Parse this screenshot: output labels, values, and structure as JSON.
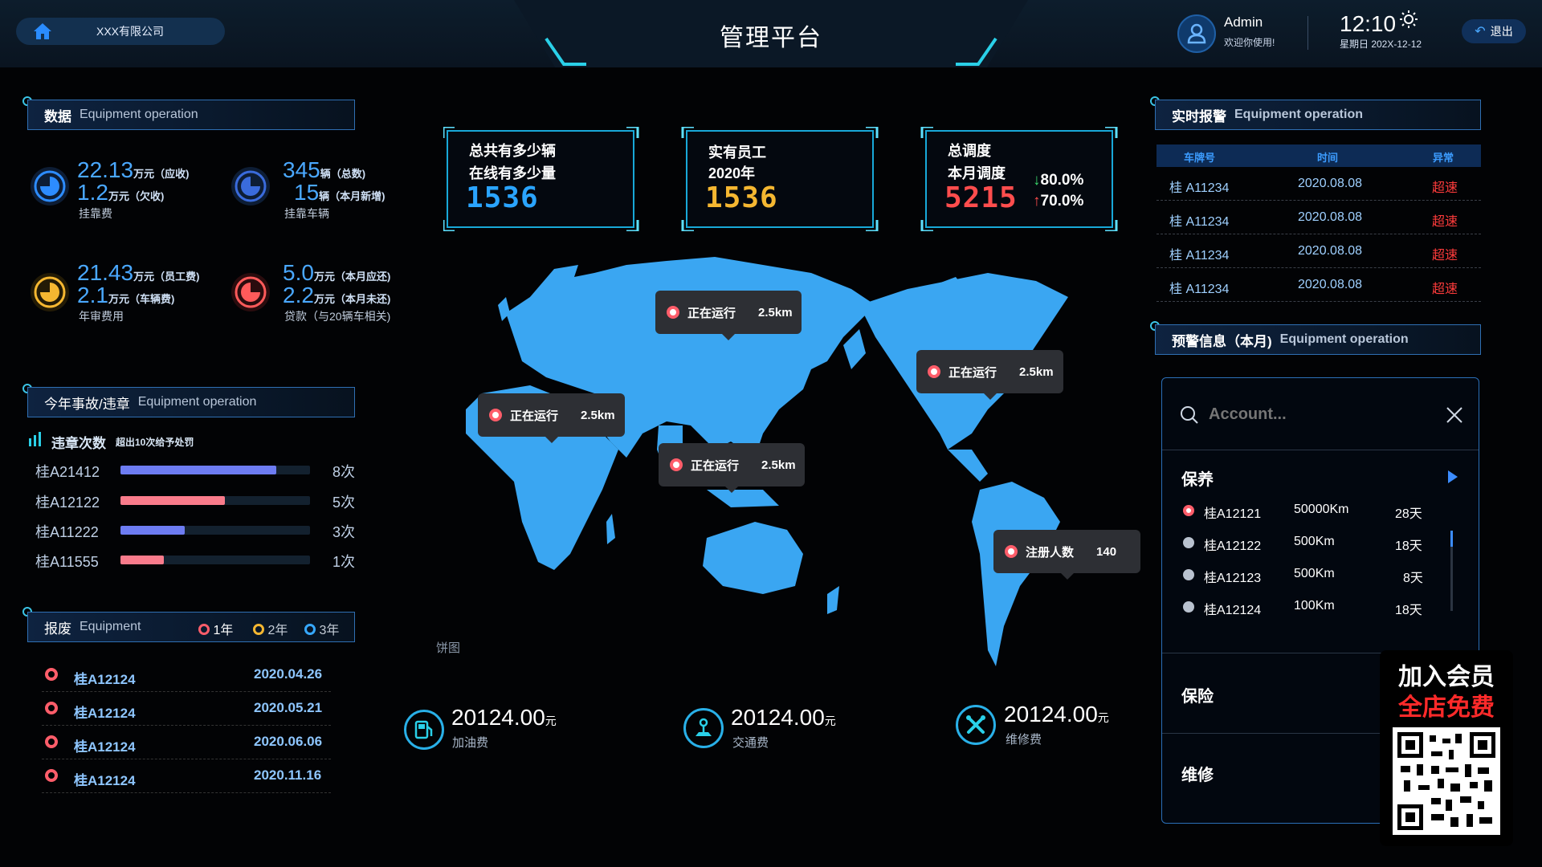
{
  "header": {
    "company": "XXX有限公司",
    "title": "管理平台",
    "user_name": "Admin",
    "user_welcome": "欢迎你使用!",
    "time": "12:10",
    "date": "星期日  202X-12-12",
    "logout": "退出"
  },
  "data_section": {
    "title": "数据",
    "subtitle": "Equipment operation",
    "stats": [
      {
        "v1": "22.13",
        "u1": "万元（应收)",
        "v2": "1.2",
        "u2": "万元（欠收)",
        "label": "挂靠费",
        "color": "#2d8cff"
      },
      {
        "v1": "345",
        "u1": "辆（总数)",
        "v2": "15",
        "u2": "辆（本月新增)",
        "label": "挂靠车辆",
        "color": "#3a6bdc"
      },
      {
        "v1": "21.43",
        "u1": "万元（员工费)",
        "v2": "2.1",
        "u2": "万元（车辆费)",
        "label": "年审费用",
        "color": "#f5b731"
      },
      {
        "v1": "5.0",
        "u1": "万元（本月应还)",
        "v2": "2.2",
        "u2": "万元（本月未还)",
        "label": "贷款（与20辆车相关)",
        "color": "#ff5a5a"
      }
    ]
  },
  "violation_section": {
    "title": "今年事故/违章",
    "subtitle": "Equipment operation",
    "legend_title": "违章次数",
    "legend_note": "超出10次给予处罚",
    "rows": [
      {
        "plate": "桂A21412",
        "count": "8次",
        "ratio": 0.82,
        "color": "#6d7cf2"
      },
      {
        "plate": "桂A12122",
        "count": "5次",
        "ratio": 0.55,
        "color": "#f97b8b"
      },
      {
        "plate": "桂A11222",
        "count": "3次",
        "ratio": 0.34,
        "color": "#6d7cf2"
      },
      {
        "plate": "桂A11555",
        "count": "1次",
        "ratio": 0.23,
        "color": "#f97b8b"
      }
    ]
  },
  "scrap_section": {
    "title": "报废",
    "subtitle": "Equipment",
    "legend": [
      {
        "label": "1年",
        "color": "#ff5d6a"
      },
      {
        "label": "2年",
        "color": "#f5b731"
      },
      {
        "label": "3年",
        "color": "#36a8ff"
      }
    ],
    "rows": [
      {
        "plate": "桂A12124",
        "date": "2020.04.26"
      },
      {
        "plate": "桂A12124",
        "date": "2020.05.21"
      },
      {
        "plate": "桂A12124",
        "date": "2020.06.06"
      },
      {
        "plate": "桂A12124",
        "date": "2020.11.16"
      }
    ]
  },
  "kpis": [
    {
      "line1": "总共有多少辆",
      "line2": "在线有多少量",
      "value": "1536",
      "color": "#2aa4ff"
    },
    {
      "line1": "实有员工",
      "line2": "2020年",
      "value": "1536",
      "color": "#f5b731"
    },
    {
      "line1": "总调度",
      "line2": "本月调度",
      "value": "5215",
      "color": "#ff4d4d",
      "down": "80.0%",
      "up": "70.0%"
    }
  ],
  "map": {
    "pins": [
      {
        "label": "正在运行",
        "value": "2.5km"
      },
      {
        "label": "正在运行",
        "value": "2.5km"
      },
      {
        "label": "正在运行",
        "value": "2.5km"
      },
      {
        "label": "正在运行",
        "value": "2.5km"
      },
      {
        "label": "注册人数",
        "value": "140"
      }
    ],
    "caption": "饼图"
  },
  "fees": [
    {
      "value": "20124.00",
      "unit": "元",
      "label": "加油费",
      "icon": "fuel-icon"
    },
    {
      "value": "20124.00",
      "unit": "元",
      "label": "交通费",
      "icon": "road-icon"
    },
    {
      "value": "20124.00",
      "unit": "元",
      "label": "维修费",
      "icon": "wrench-icon"
    }
  ],
  "alarm_section": {
    "title": "实时报警",
    "subtitle": "Equipment operation",
    "columns": [
      "车牌号",
      "时间",
      "异常"
    ],
    "rows": [
      {
        "plate": "桂 A11234",
        "time": "2020.08.08",
        "status": "超速"
      },
      {
        "plate": "桂 A11234",
        "time": "2020.08.08",
        "status": "超速"
      },
      {
        "plate": "桂 A11234",
        "time": "2020.08.08",
        "status": "超速"
      },
      {
        "plate": "桂 A11234",
        "time": "2020.08.08",
        "status": "超速"
      }
    ]
  },
  "warning_section": {
    "title": "预警信息（本月)",
    "subtitle": "Equipment operation",
    "search_placeholder": "Account...",
    "groups": [
      {
        "name": "保养"
      },
      {
        "name": "保险"
      },
      {
        "name": "维修"
      }
    ],
    "items": [
      {
        "plate": "桂A12121",
        "km": "50000Km",
        "days": "28天"
      },
      {
        "plate": "桂A12122",
        "km": "500Km",
        "days": "18天"
      },
      {
        "plate": "桂A12123",
        "km": "500Km",
        "days": "8天"
      },
      {
        "plate": "桂A12124",
        "km": "100Km",
        "days": "18天"
      }
    ]
  },
  "promo": {
    "line1": "加入会员",
    "line2": "全店免费"
  }
}
